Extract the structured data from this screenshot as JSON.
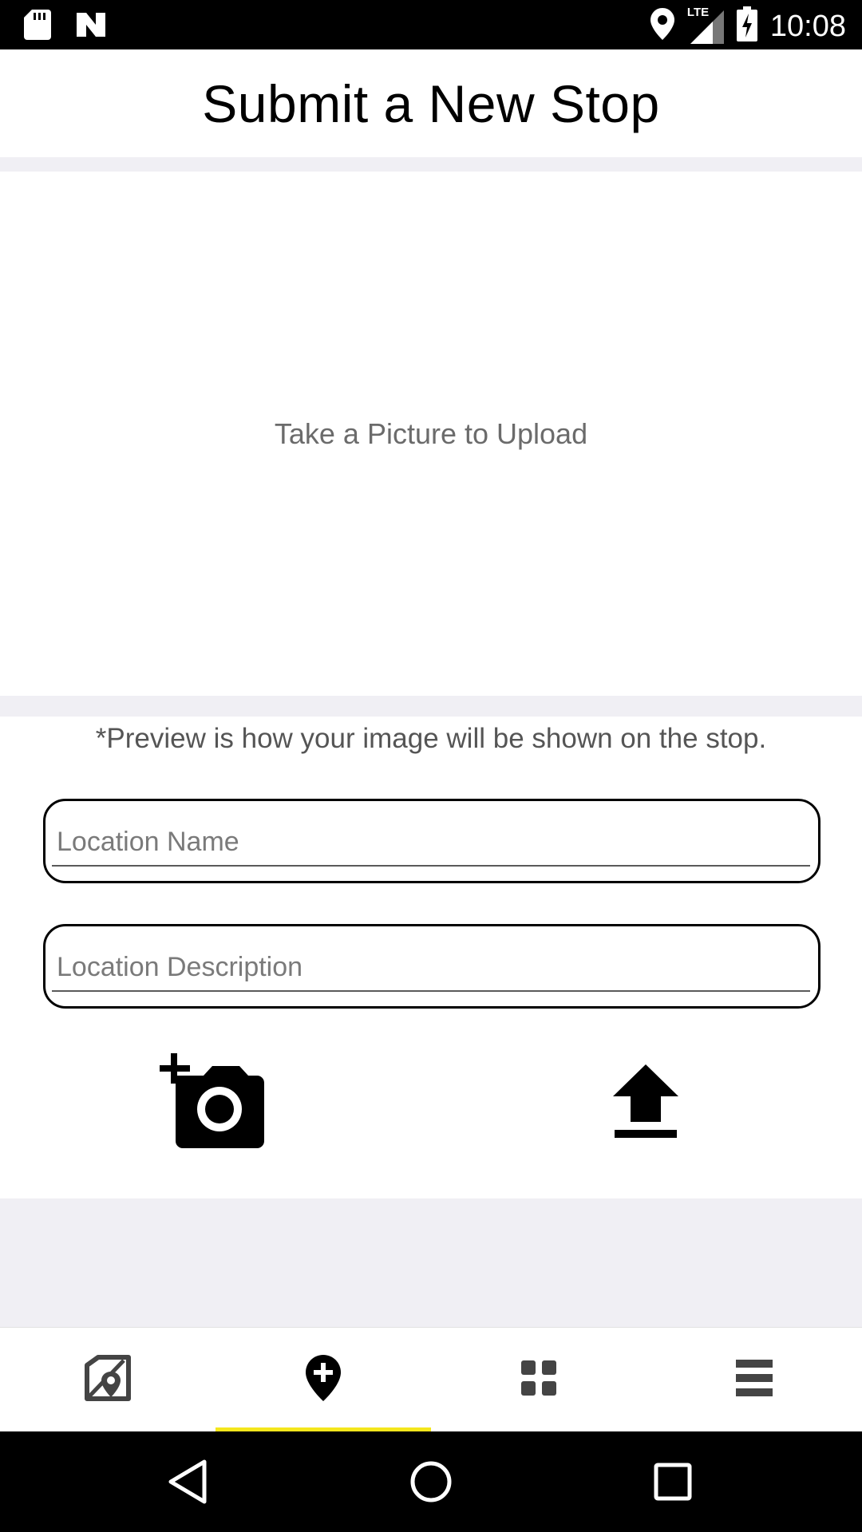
{
  "status_bar": {
    "time": "10:08",
    "network_label": "LTE"
  },
  "header": {
    "title": "Submit a New Stop"
  },
  "preview": {
    "placeholder_text": "Take a Picture to Upload"
  },
  "form": {
    "note": "*Preview is how your image will be shown on the stop.",
    "location_name": {
      "placeholder": "Location Name",
      "value": ""
    },
    "location_description": {
      "placeholder": "Location Description",
      "value": ""
    },
    "actions": [
      {
        "icon": "add-photo-icon"
      },
      {
        "icon": "upload-icon"
      }
    ]
  },
  "bottom_nav": {
    "items": [
      {
        "icon": "map-icon",
        "active": false
      },
      {
        "icon": "add-location-icon",
        "active": true
      },
      {
        "icon": "grid-icon",
        "active": false
      },
      {
        "icon": "menu-icon",
        "active": false
      }
    ],
    "active_indicator_color": "#f4e61c"
  },
  "system_nav": {
    "buttons": [
      "back-icon",
      "home-icon",
      "recents-icon"
    ]
  }
}
